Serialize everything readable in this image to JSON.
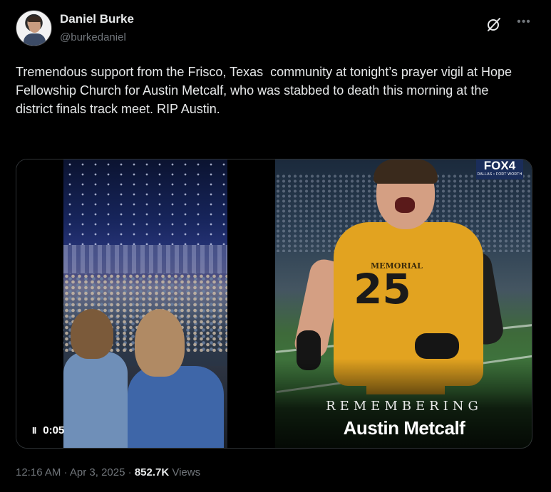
{
  "author": {
    "name": "Daniel Burke",
    "handle": "@burkedaniel"
  },
  "tweet": {
    "text": "Tremendous support from the Frisco, Texas  community at tonight’s prayer vigil at Hope Fellowship Church for Austin Metcalf, who was stabbed to death this morning at the district finals track meet. RIP Austin."
  },
  "media": {
    "video": {
      "timestamp": "0:05",
      "pause_symbol": "II"
    },
    "photo": {
      "logo_main": "FOX4",
      "logo_sub": "DALLAS • FORT WORTH",
      "jersey_school": "MEMORIAL",
      "jersey_number": "25",
      "caption_top": "REMEMBERING",
      "caption_name": "Austin Metcalf"
    }
  },
  "meta": {
    "time": "12:16 AM",
    "separator": "·",
    "date": "Apr 3, 2025",
    "views_count": "852.7K",
    "views_label": "Views"
  },
  "icons": {
    "grok": "grok-icon",
    "more": "more-icon",
    "pause": "pause-icon"
  }
}
